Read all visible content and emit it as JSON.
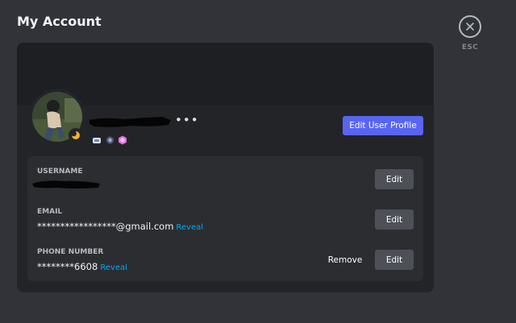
{
  "page": {
    "title": "My Account"
  },
  "close": {
    "icon": "close-icon",
    "label": "ESC"
  },
  "profile": {
    "username_display": "",
    "more_icon": "ellipsis-icon",
    "status": "idle-moon-icon",
    "badges": [
      "hypesquad-badge-icon",
      "nitro-badge-icon",
      "server-boost-badge-icon"
    ],
    "edit_profile_label": "Edit User Profile"
  },
  "fields": {
    "username": {
      "label": "USERNAME",
      "value": "",
      "edit_label": "Edit"
    },
    "email": {
      "label": "EMAIL",
      "value": "*****************@gmail.com",
      "reveal_label": "Reveal",
      "edit_label": "Edit"
    },
    "phone": {
      "label": "PHONE NUMBER",
      "value": "********6608",
      "reveal_label": "Reveal",
      "remove_label": "Remove",
      "edit_label": "Edit"
    }
  },
  "colors": {
    "background": "#313338",
    "card": "#232428",
    "fields_panel": "#2b2d31",
    "accent": "#5865f2",
    "link": "#00a8fc",
    "secondary_button": "#4e5058"
  }
}
